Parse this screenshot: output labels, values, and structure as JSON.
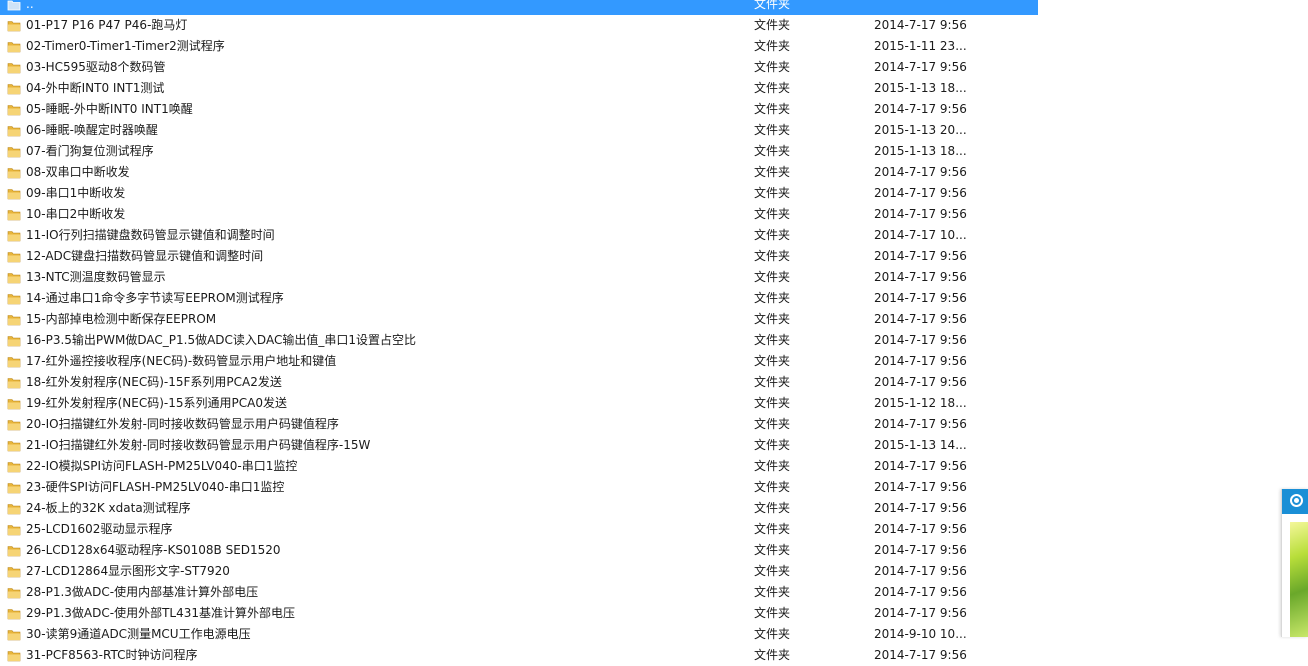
{
  "explorer": {
    "selected_row": {
      "name": "..",
      "type": "文件夹",
      "date": ""
    },
    "rows": [
      {
        "name": "01-P17 P16 P47 P46-跑马灯",
        "type": "文件夹",
        "date": "2014-7-17 9:56"
      },
      {
        "name": "02-Timer0-Timer1-Timer2测试程序",
        "type": "文件夹",
        "date": "2015-1-11 23..."
      },
      {
        "name": "03-HC595驱动8个数码管",
        "type": "文件夹",
        "date": "2014-7-17 9:56"
      },
      {
        "name": "04-外中断INT0 INT1测试",
        "type": "文件夹",
        "date": "2015-1-13 18..."
      },
      {
        "name": "05-睡眠-外中断INT0 INT1唤醒",
        "type": "文件夹",
        "date": "2014-7-17 9:56"
      },
      {
        "name": "06-睡眠-唤醒定时器唤醒",
        "type": "文件夹",
        "date": "2015-1-13 20..."
      },
      {
        "name": "07-看门狗复位测试程序",
        "type": "文件夹",
        "date": "2015-1-13 18..."
      },
      {
        "name": "08-双串口中断收发",
        "type": "文件夹",
        "date": "2014-7-17 9:56"
      },
      {
        "name": "09-串口1中断收发",
        "type": "文件夹",
        "date": "2014-7-17 9:56"
      },
      {
        "name": "10-串口2中断收发",
        "type": "文件夹",
        "date": "2014-7-17 9:56"
      },
      {
        "name": "11-IO行列扫描键盘数码管显示键值和调整时间",
        "type": "文件夹",
        "date": "2014-7-17 10..."
      },
      {
        "name": "12-ADC键盘扫描数码管显示键值和调整时间",
        "type": "文件夹",
        "date": "2014-7-17 9:56"
      },
      {
        "name": "13-NTC测温度数码管显示",
        "type": "文件夹",
        "date": "2014-7-17 9:56"
      },
      {
        "name": "14-通过串口1命令多字节读写EEPROM测试程序",
        "type": "文件夹",
        "date": "2014-7-17 9:56"
      },
      {
        "name": "15-内部掉电检测中断保存EEPROM",
        "type": "文件夹",
        "date": "2014-7-17 9:56"
      },
      {
        "name": "16-P3.5输出PWM做DAC_P1.5做ADC读入DAC输出值_串口1设置占空比",
        "type": "文件夹",
        "date": "2014-7-17 9:56"
      },
      {
        "name": "17-红外遥控接收程序(NEC码)-数码管显示用户地址和键值",
        "type": "文件夹",
        "date": "2014-7-17 9:56"
      },
      {
        "name": "18-红外发射程序(NEC码)-15F系列用PCA2发送",
        "type": "文件夹",
        "date": "2014-7-17 9:56"
      },
      {
        "name": "19-红外发射程序(NEC码)-15系列通用PCA0发送",
        "type": "文件夹",
        "date": "2015-1-12 18..."
      },
      {
        "name": "20-IO扫描键红外发射-同时接收数码管显示用户码键值程序",
        "type": "文件夹",
        "date": "2014-7-17 9:56"
      },
      {
        "name": "21-IO扫描键红外发射-同时接收数码管显示用户码键值程序-15W",
        "type": "文件夹",
        "date": "2015-1-13 14..."
      },
      {
        "name": "22-IO模拟SPI访问FLASH-PM25LV040-串口1监控",
        "type": "文件夹",
        "date": "2014-7-17 9:56"
      },
      {
        "name": "23-硬件SPI访问FLASH-PM25LV040-串口1监控",
        "type": "文件夹",
        "date": "2014-7-17 9:56"
      },
      {
        "name": "24-板上的32K xdata测试程序",
        "type": "文件夹",
        "date": "2014-7-17 9:56"
      },
      {
        "name": "25-LCD1602驱动显示程序",
        "type": "文件夹",
        "date": "2014-7-17 9:56"
      },
      {
        "name": "26-LCD128x64驱动程序-KS0108B SED1520",
        "type": "文件夹",
        "date": "2014-7-17 9:56"
      },
      {
        "name": "27-LCD12864显示图形文字-ST7920",
        "type": "文件夹",
        "date": "2014-7-17 9:56"
      },
      {
        "name": "28-P1.3做ADC-使用内部基准计算外部电压",
        "type": "文件夹",
        "date": "2014-7-17 9:56"
      },
      {
        "name": "29-P1.3做ADC-使用外部TL431基准计算外部电压",
        "type": "文件夹",
        "date": "2014-7-17 9:56"
      },
      {
        "name": "30-读第9通道ADC测量MCU工作电源电压",
        "type": "文件夹",
        "date": "2014-9-10 10..."
      },
      {
        "name": "31-PCF8563-RTC时钟访问程序",
        "type": "文件夹",
        "date": "2014-7-17 9:56"
      }
    ]
  },
  "side_widget": {
    "icon": "app-logo-icon"
  },
  "colors": {
    "selection": "#3399ff",
    "folder": "#e8b53a",
    "widget_accent": "#1a8fd6"
  }
}
